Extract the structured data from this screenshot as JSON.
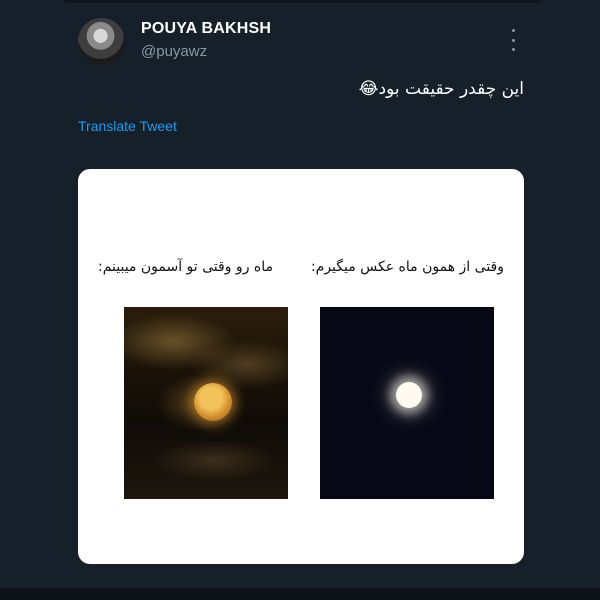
{
  "tweet": {
    "display_name": "POUYA BAKHSH",
    "handle": "@puyawz",
    "text": "این چقدر حقیقت بود😂",
    "translate_label": "Translate Tweet"
  },
  "meme": {
    "left_caption": "ماه رو وقتی تو آسمون میبینم:",
    "right_caption": "وقتی از همون ماه عکس میگیرم:"
  }
}
